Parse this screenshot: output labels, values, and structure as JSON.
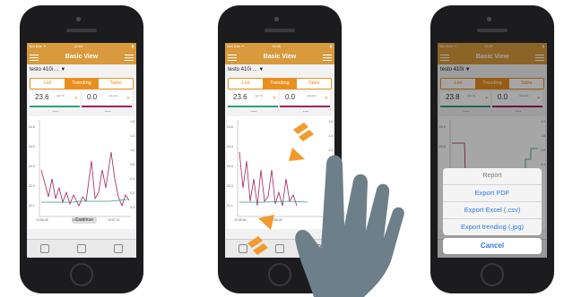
{
  "phones": [
    {
      "statusbar": {
        "carrier": "Sim free ᯤ",
        "time": "12:44",
        "battery": "▮"
      },
      "nav": {
        "title": "Basic View"
      },
      "device": {
        "name": "testo 410i ..."
      },
      "tabs": [
        "List",
        "Trending",
        "Table"
      ],
      "readings": [
        {
          "value": "23.6",
          "unit": "m/s °C"
        },
        {
          "value": "0.0",
          "unit": "m/s m/s"
        }
      ],
      "dashes": [
        "----",
        "----"
      ],
      "chart": {
        "left_ticks": [
          "24.6",
          "24.0",
          "23.5",
          "22.0",
          "21.1"
        ],
        "right_ticks": [
          "1.6",
          "1.4",
          "1.0",
          "0.8",
          "0.4",
          "0.2",
          "0.0"
        ],
        "x_ticks": [
          "10:55:45",
          "10:57:22",
          "10:57:21"
        ],
        "continue_label": "Continue"
      }
    },
    {
      "statusbar": {
        "carrier": "Sim free ᯤ",
        "time": "10:45",
        "battery": "▮"
      },
      "nav": {
        "title": "Basic View"
      },
      "device": {
        "name": "testo 410i ..."
      },
      "tabs": [
        "List",
        "Trending",
        "Table"
      ],
      "readings": [
        {
          "value": "23.6",
          "unit": "m/s °C"
        },
        {
          "value": "0.0",
          "unit": "m/s m/s"
        }
      ],
      "dashes": [
        "----",
        "----"
      ],
      "chart": {
        "left_ticks": [
          "24.6",
          "24.0",
          "23.5",
          "22.0",
          "21.1"
        ],
        "right_ticks": [
          "1.6",
          "1.4",
          "1.0",
          "0.8",
          "0.4",
          "0.2"
        ],
        "x_ticks": [
          "10:55:00",
          "10:56:45"
        ],
        "continue_label": ""
      }
    },
    {
      "statusbar": {
        "carrier": "Sim free ᯤ",
        "time": "15:49",
        "battery": "▮"
      },
      "nav": {
        "title": "Basic View"
      },
      "device": {
        "name": "testo 410i"
      },
      "tabs": [
        "List",
        "Trending",
        "Table"
      ],
      "readings": [
        {
          "value": "23.8",
          "unit": "m/s °C"
        },
        {
          "value": "0.0",
          "unit": "m/s m/s"
        }
      ],
      "dashes": [
        "----",
        "----"
      ],
      "chart": {
        "left_ticks": [
          "24.0",
          "23.5"
        ],
        "right_ticks": [
          "2.0",
          "1.8",
          "1.6",
          "1.4"
        ],
        "x_ticks": [],
        "continue_label": ""
      },
      "action_sheet": {
        "header": "Report",
        "options": [
          "Export PDF",
          "Export Excel (.csv)",
          "Export trending (.jpg)"
        ],
        "cancel": "Cancel"
      }
    }
  ],
  "colors": {
    "accent": "#e8901f",
    "temp_series": "#2e9f7c",
    "humidity_series": "#a0215a",
    "arrow": "#f29a2e",
    "hand": "#6d7f88"
  }
}
